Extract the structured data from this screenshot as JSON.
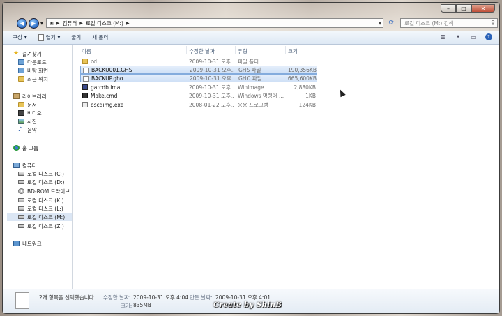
{
  "window": {
    "minimize": "–",
    "maximize": "□",
    "close": "✕"
  },
  "address": {
    "crumbs": [
      "컴퓨터",
      "로컬 디스크 (M:)"
    ],
    "search_placeholder": "로컬 디스크 (M:) 검색"
  },
  "toolbar": {
    "organize": "구성",
    "open": "열기",
    "burn": "굽기",
    "new_folder": "새 폴더"
  },
  "nav": {
    "favorites": "즐겨찾기",
    "downloads": "다운로드",
    "desktop": "바탕 화면",
    "recent": "최근 위치",
    "libraries": "라이브러리",
    "documents": "문서",
    "videos": "비디오",
    "pictures": "사진",
    "music": "음악",
    "homegroup": "홈 그룹",
    "computer": "컴퓨터",
    "drive_c": "로컬 디스크 (C:)",
    "drive_d": "로컬 디스크 (D:)",
    "bd_rom": "BD-ROM 드라이브 (",
    "drive_k": "로컬 디스크 (K:)",
    "drive_l": "로컬 디스크 (L:)",
    "drive_m": "로컬 디스크 (M:)",
    "drive_z": "로컬 디스크 (Z:)",
    "network": "네트워크"
  },
  "columns": {
    "name": "이름",
    "date": "수정한 날짜",
    "type": "유형",
    "size": "크기"
  },
  "files": [
    {
      "name": "cd",
      "date": "2009-10-31 오후...",
      "type": "파일 폴더",
      "size": ""
    },
    {
      "name": "BACKU001.GHS",
      "date": "2009-10-31 오후...",
      "type": "GHS 파일",
      "size": "190,356KB"
    },
    {
      "name": "BACKUP.gho",
      "date": "2009-10-31 오후...",
      "type": "GHO 파일",
      "size": "665,600KB"
    },
    {
      "name": "garcdb.ima",
      "date": "2009-10-31 오후...",
      "type": "WinImage",
      "size": "2,880KB"
    },
    {
      "name": "Make.cmd",
      "date": "2009-10-31 오후...",
      "type": "Windows 명령어 ...",
      "size": "1KB"
    },
    {
      "name": "oscdimg.exe",
      "date": "2008-01-22 오후...",
      "type": "응용 프로그램",
      "size": "124KB"
    }
  ],
  "details": {
    "selected": "2개 항목을 선택했습니다.",
    "modified_label": "수정한 날짜:",
    "modified_value": "2009-10-31 오후 4:04",
    "created_label": "만든 날짜:",
    "created_value": "2009-10-31 오후 4:01",
    "size_label": "크기:",
    "size_value": "835MB"
  },
  "watermark": "Create by ShinB"
}
